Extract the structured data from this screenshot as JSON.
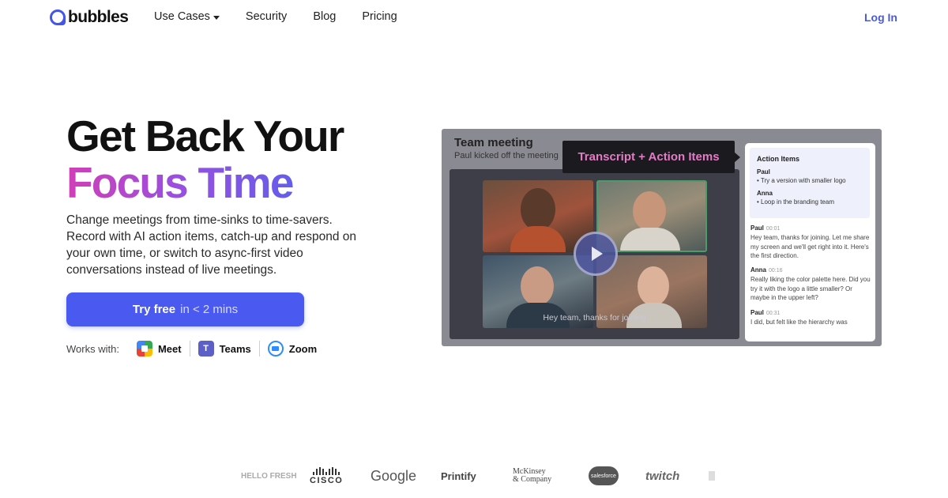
{
  "nav": {
    "logo_text": "bubbles",
    "links": [
      {
        "label": "Use Cases",
        "has_dropdown": true
      },
      {
        "label": "Security"
      },
      {
        "label": "Blog"
      },
      {
        "label": "Pricing"
      }
    ],
    "login": "Log In"
  },
  "hero": {
    "title_line1": "Get Back Your",
    "title_line2": "Focus Time",
    "subtitle": "Change meetings from time-sinks to time-savers. Record with AI action items, catch-up and respond on your own time, or switch to async-first video conversations instead of live meetings.",
    "cta_main": "Try free",
    "cta_sub": "in < 2 mins",
    "works_with_label": "Works with:",
    "apps": [
      "Meet",
      "Teams",
      "Zoom"
    ]
  },
  "preview": {
    "meeting_title": "Team meeting",
    "meeting_sub": "Paul kicked off the meeting",
    "badge": "Transcript + Action Items",
    "caption": "Hey team, thanks for joining",
    "action_items": {
      "title": "Action Items",
      "groups": [
        {
          "name": "Paul",
          "item": "• Try a version with smaller logo"
        },
        {
          "name": "Anna",
          "item": "• Loop in the branding team"
        }
      ]
    },
    "transcript": [
      {
        "name": "Paul",
        "time": "00:01",
        "text": "Hey team, thanks for joining. Let me share my screen and we'll get right into it. Here's the first direction."
      },
      {
        "name": "Anna",
        "time": "00:16",
        "text": "Really liking the color palette here. Did you try it with the logo a little smaller? Or maybe in the upper left?"
      },
      {
        "name": "Paul",
        "time": "00:31",
        "text": "I did, but felt like the hierarchy was"
      }
    ]
  },
  "logos": {
    "hellofresh": "HELLO FRESH",
    "cisco": "CISCO",
    "google": "Google",
    "printify": "Printify",
    "mckinsey_1": "McKinsey",
    "mckinsey_2": "& Company",
    "salesforce": "salesforce",
    "twitch": "twitch"
  },
  "colors": {
    "accent": "#4a59f0",
    "gradient_start": "#d13fb8",
    "gradient_end": "#4d63f0",
    "login": "#4a5bd9",
    "badge_text": "#e57ac6"
  }
}
